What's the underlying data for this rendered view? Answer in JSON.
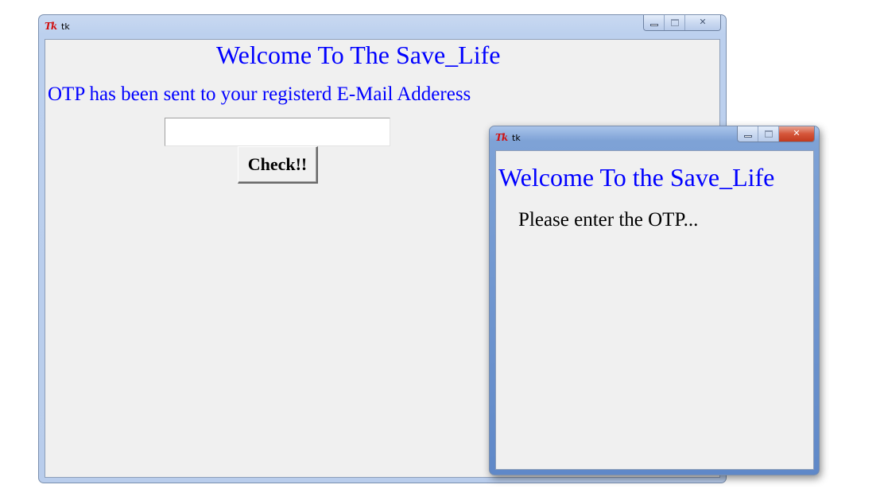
{
  "main_window": {
    "title": "tk",
    "logo_text": "Tk",
    "heading": "Welcome To The Save_Life",
    "message": "OTP has been sent to your registerd E-Mail Adderess",
    "otp_input": {
      "value": "",
      "placeholder": ""
    },
    "check_button_label": "Check!!",
    "state": "inactive"
  },
  "popup_window": {
    "title": "tk",
    "logo_text": "Tk",
    "heading": "Welcome To the Save_Life",
    "message": "Please enter the OTP...",
    "state": "active"
  },
  "caption_buttons": {
    "close_glyph": "✕"
  },
  "colors": {
    "heading_text": "#0000ff",
    "body_text": "#000000",
    "client_background": "#f0f0f0",
    "close_button_active": "#c13a1f"
  }
}
